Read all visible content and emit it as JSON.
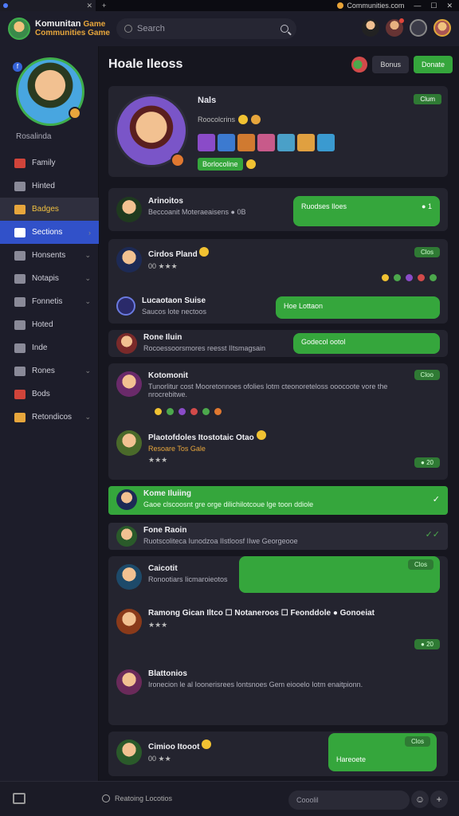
{
  "window": {
    "tab_title": "",
    "title_text": "Communities.com",
    "plus": "+"
  },
  "header": {
    "app_name_1": "Komunitan",
    "app_name_2": "Game",
    "app_tagline": "Communities Game",
    "search_placeholder": "Search"
  },
  "sidebar": {
    "profile_name": "Rosalinda",
    "items": [
      {
        "label": "Family"
      },
      {
        "label": "Hinted"
      },
      {
        "label": "Badges"
      },
      {
        "label": "Sections"
      },
      {
        "label": "Honsents"
      },
      {
        "label": "Notapis"
      },
      {
        "label": "Fonnetis"
      },
      {
        "label": "Hoted"
      },
      {
        "label": "Inde"
      },
      {
        "label": "Rones"
      },
      {
        "label": "Bods"
      },
      {
        "label": "Retondicos"
      }
    ]
  },
  "main": {
    "title": "Hoale Ileoss",
    "btn_dark": "Bonus",
    "btn_green": "Donate",
    "hero": {
      "name": "Nals",
      "sub": "Roocolcrins",
      "tag": "Borlocoline",
      "pill": "Clum"
    },
    "posts": [
      {
        "name": "Arinoitos",
        "sub": "Beccoanit Moteraeaisens ● 0B",
        "bubble": "Ruodses Iloes",
        "bubble_meta": "● 1"
      },
      {
        "name": "Cirdos Pland",
        "stats": "00 ★★★",
        "pill": "Clos",
        "sub_name": "Lucaotaon Suise",
        "sub_text": "Saucos lote nectoos",
        "bubble": "Hoe Lottaon"
      },
      {
        "name": "Rone Iluin",
        "sub": "Rocoessoorsmores reesst IItsmagsain",
        "bubble": "Godecol ootol"
      },
      {
        "name": "Kotomonit",
        "sub": "Tunorlitur cost Mooretonnoes ofolies lotm cteonoreteloss ooocoote vore the nrocrebitwe.",
        "pill": "Cloo",
        "name2": "Plaotofdoles Itostotaic Otao",
        "sub2": "Resoare Tos Gale",
        "pill2": "● 20"
      },
      {
        "name": "Kome Iluiing",
        "sub": "Gaoe clscoosnt gre orge dilichilotcoue lge toon ddiole"
      },
      {
        "name": "Fone Raoin",
        "sub": "Ruotscoliteca Iunodzoa IIstloosf IIwe Georgeooe"
      },
      {
        "name": "Caicotit",
        "sub": "Ronootiars Iicmaroieotos",
        "bubble_pill": "Clos",
        "name2": "Ramong Gican Iltco ☐ Notaneroos ☐ Feonddole ● Gonoeiat",
        "pill2": "● 20",
        "name3": "Blattonios",
        "sub3": "Ironecion le al Ioonerisrees lontsnoes Gem eiooelo Iotm enaitpionn."
      },
      {
        "name": "Cimioo Itooot",
        "stats": "00 ★★",
        "bubble": "Hareoete",
        "bubble_pill": "Clos"
      }
    ]
  },
  "bottombar": {
    "status": "Reatoing Locotios",
    "compose_placeholder": "Cooolil"
  }
}
